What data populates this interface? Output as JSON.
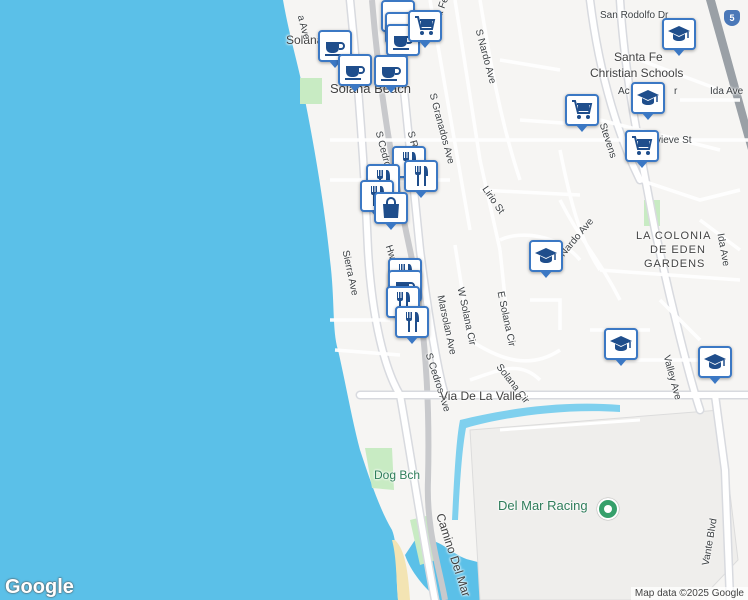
{
  "map": {
    "place_labels": {
      "solana_beach_top": "Solana Bch",
      "solana_beach": "Solana Beach",
      "santa_fe_schools_1": "Santa Fe",
      "santa_fe_schools_2": "Christian Schools",
      "colonia_1": "LA COLONIA",
      "colonia_2": "DE EDEN",
      "colonia_3": "GARDENS",
      "dog_beach": "Dog Bch",
      "del_mar_racing": "Del Mar Racing"
    },
    "streets": {
      "san_rodolfo": "San Rodolfo Dr",
      "s_nardo": "S Nardo Ave",
      "s_granados": "S Granados Ave",
      "s_rios": "S Rios Ave",
      "s_cedros_top": "S Cedros",
      "santa_fe_dr": "Santa Fe Dr",
      "lirio": "Lirio St",
      "sierra": "Sierra Ave",
      "hwy_101": "Hwy 101",
      "marsolan": "Marsolan Ave",
      "w_solana_cir": "W Solana Cir",
      "e_solana_cir": "E Solana Cir",
      "solana_cir": "Solana Cir",
      "s_cedros": "S Cedros Ave",
      "via_de_la_valle": "Via De La Valle",
      "camino_del_mar": "Camino Del Mar",
      "valley_ave": "Valley Ave",
      "nardo_ave": "Nardo Ave",
      "stevens": "Stevens",
      "genevieve": "vieve St",
      "ida_ave_top": "Ida Ave",
      "ida_ave": "Ida Ave",
      "acacia": "Ac",
      "acacia2": "r",
      "vulcan": "a Ave",
      "solana_vista": "Vante Blvd"
    },
    "highway_shield": "5",
    "google_logo": "Google",
    "attribution": "Map data ©2025 Google",
    "colors": {
      "ocean": "#5bc0e8",
      "land": "#f6f5f3",
      "road": "#ffffff",
      "road_outline": "#d8dadf",
      "highway": "#9aa0a6",
      "park": "#c8ebc3",
      "pin_border": "#3b78c4",
      "pin_icon": "#1f4e8c"
    },
    "markers": [
      {
        "id": "cafe-1",
        "icon": "coffee-cup"
      },
      {
        "id": "cafe-2",
        "icon": "coffee-cup"
      },
      {
        "id": "cafe-3",
        "icon": "coffee-cup"
      },
      {
        "id": "cafe-4",
        "icon": "coffee-cup"
      },
      {
        "id": "cafe-5",
        "icon": "coffee-cup"
      },
      {
        "id": "cafe-6",
        "icon": "coffee-cup"
      },
      {
        "id": "shop-1",
        "icon": "shopping-cart"
      },
      {
        "id": "school-1",
        "icon": "graduation-cap"
      },
      {
        "id": "school-2",
        "icon": "graduation-cap"
      },
      {
        "id": "shop-2",
        "icon": "shopping-cart"
      },
      {
        "id": "shop-3",
        "icon": "shopping-cart"
      },
      {
        "id": "rest-1",
        "icon": "fork-knife"
      },
      {
        "id": "rest-2",
        "icon": "fork-knife"
      },
      {
        "id": "rest-3",
        "icon": "fork-knife"
      },
      {
        "id": "rest-4",
        "icon": "fork-knife"
      },
      {
        "id": "bag-1",
        "icon": "shopping-bag"
      },
      {
        "id": "school-3",
        "icon": "graduation-cap"
      },
      {
        "id": "rest-5",
        "icon": "fork-knife"
      },
      {
        "id": "cafe-7",
        "icon": "coffee-cup"
      },
      {
        "id": "rest-6",
        "icon": "fork-knife"
      },
      {
        "id": "rest-7",
        "icon": "fork-knife"
      },
      {
        "id": "school-4",
        "icon": "graduation-cap"
      },
      {
        "id": "school-5",
        "icon": "graduation-cap"
      }
    ]
  }
}
